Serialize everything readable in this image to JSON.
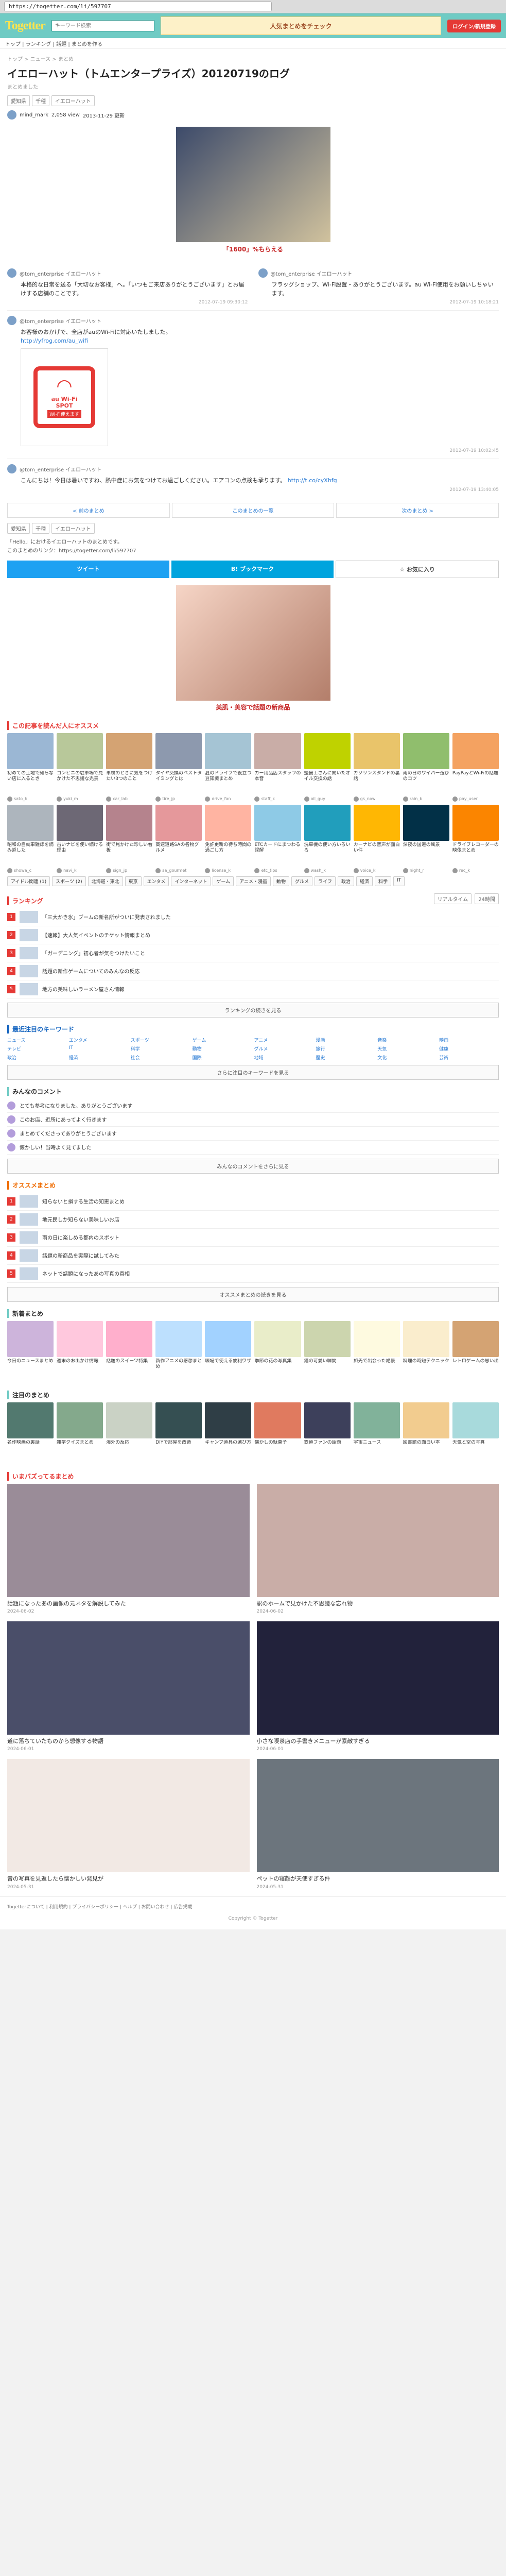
{
  "browser": {
    "url": "https://togetter.com/li/597707"
  },
  "header": {
    "logo": "Togetter",
    "search_placeholder": "キーワード検索",
    "banner_text": "人気まとめをチェック",
    "login": "ログイン/新規登録",
    "submenu": "トップ | ランキング | 話題 | まとめを作る"
  },
  "article": {
    "breadcrumb": "トップ > ニュース > まとめ",
    "title": "イエローハット（トムエンタープライズ）20120719のログ",
    "subtitle": "まとめました",
    "views": "2,058 view",
    "date": "2013-11-29 更新",
    "tags": [
      "愛知県",
      "千種",
      "イエローハット"
    ],
    "author_name": "mind_mark",
    "author_count": "2,058",
    "ad_caption": "「1600」%もらえる",
    "tweets": [
      {
        "user": "@tom_enterprise イエローハット",
        "text": "本格的な日常を送る「大切なお客様」へ。「いつもご来店ありがとうございます」とお届けする店舗のことです。",
        "time": "2012-07-19 09:30:12",
        "has_image": false
      },
      {
        "user": "@tom_enterprise イエローハット",
        "text": "お客様のおかげで、全店がauのWi-Fiに対応いたしました。",
        "link": "http://yfrog.com/au_wifi",
        "time": "2012-07-19 10:02:45",
        "has_image": true
      },
      {
        "user": "@tom_enterprise イエローハット",
        "text": "フラッグショップ、Wi-Fi設置・ありがとうございます。au Wi-Fi使用をお願いしちゃいます。",
        "time": "2012-07-19 10:18:21",
        "has_image": false
      },
      {
        "user": "@tom_enterprise イエローハット",
        "text": "こんにちは！今日は暑いですね、熱中症にお気をつけてお過ごしください。エアコンの点検も承ります。",
        "link": "http://t.co/cyXhfg",
        "time": "2012-07-19 13:40:05",
        "has_image": false
      }
    ],
    "wifi_badge": {
      "brand": "au Wi-Fi",
      "label": "SPOT",
      "sub": "Wi-Fi使えます"
    },
    "pager": [
      "< 前のまとめ",
      "このまとめの一覧",
      "次のまとめ >"
    ],
    "share": {
      "twitter": "ツイート",
      "hatebu": "B! ブックマーク",
      "fav": "☆ お気に入り"
    },
    "info": [
      "「Hello」におけるイエローハットのまとめです。",
      "このまとめのリンク：https://togetter.com/li/597707"
    ]
  },
  "ad2": {
    "caption": "美肌・美容で話題の新商品"
  },
  "sections": {
    "similar": "この記事を読んだ人にオススメ",
    "ranking": "ランキング",
    "ranking_tabs": [
      "リアルタイム",
      "24時間"
    ],
    "keywords": "最近注目のキーワード",
    "comments": "みんなのコメント",
    "recommend": "オススメまとめ",
    "new": "新着まとめ",
    "pickup": "注目のまとめ",
    "hot": "いまバズってるまとめ"
  },
  "similar_cards": [
    {
      "title": "初めての土地で知らない店に入るとき",
      "user": "sato_k",
      "color": "#9bb7d4"
    },
    {
      "title": "コンビニの駐車場で見かけた不思議な光景",
      "user": "yuki_m",
      "color": "#b8c89a"
    },
    {
      "title": "車検のときに気をつけたい3つのこと",
      "user": "car_lab",
      "color": "#d4a373"
    },
    {
      "title": "タイヤ交換のベストタイミングとは",
      "user": "tire_jp",
      "color": "#8d99ae"
    },
    {
      "title": "夏のドライブで役立つ豆知識まとめ",
      "user": "drive_fan",
      "color": "#a5c4d4"
    },
    {
      "title": "カー用品店スタッフの本音",
      "user": "staff_k",
      "color": "#c9ada7"
    },
    {
      "title": "整備士さんに聞いたオイル交換の話",
      "user": "oil_guy",
      "color": "#bfd200"
    },
    {
      "title": "ガソリンスタンドの裏話",
      "user": "gs_now",
      "color": "#e9c46a"
    },
    {
      "title": "雨の日のワイパー選びのコツ",
      "user": "rain_k",
      "color": "#90be6d"
    },
    {
      "title": "PayPayとWi-Fiの話題",
      "user": "pay_user",
      "color": "#f4a261"
    },
    {
      "title": "昭和の自動車雑誌を読み返した",
      "user": "showa_c",
      "color": "#adb5bd"
    },
    {
      "title": "古いナビを使い続ける理由",
      "user": "navi_k",
      "color": "#6d6875"
    },
    {
      "title": "街で見かけた珍しい看板",
      "user": "sign_jp",
      "color": "#b5838d"
    },
    {
      "title": "高速道路SAの名物グルメ",
      "user": "sa_gourmet",
      "color": "#e5989b"
    },
    {
      "title": "免許更新の待ち時間の過ごし方",
      "user": "license_k",
      "color": "#ffb4a2"
    },
    {
      "title": "ETCカードにまつわる誤解",
      "user": "etc_tips",
      "color": "#8ecae6"
    },
    {
      "title": "洗車機の使い方いろいろ",
      "user": "wash_k",
      "color": "#219ebc"
    },
    {
      "title": "カーナビの音声が面白い件",
      "user": "voice_k",
      "color": "#ffb703"
    },
    {
      "title": "深夜の国道の風景",
      "user": "night_r",
      "color": "#023047"
    },
    {
      "title": "ドライブレコーダーの映像まとめ",
      "user": "rec_k",
      "color": "#fb8500"
    }
  ],
  "chips": [
    "アイドル関連 (1)",
    "スポーツ (2)",
    "北海道・東北",
    "東京",
    "エンタメ",
    "インターネット",
    "ゲーム",
    "アニメ・漫画",
    "動物",
    "グルメ",
    "ライフ",
    "政治",
    "経済",
    "科学",
    "IT"
  ],
  "ranking_rows": [
    "「三大かき氷」ブームの新名所がついに発表されました",
    "【速報】大人気イベントのチケット情報まとめ",
    "「ガーデニング」初心者が気をつけたいこと",
    "話題の新作ゲームについてのみんなの反応",
    "地方の美味しいラーメン屋さん情報"
  ],
  "ranking_more": "ランキングの続きを見る",
  "keywords": [
    "ニュース",
    "エンタメ",
    "スポーツ",
    "ゲーム",
    "アニメ",
    "漫画",
    "音楽",
    "映画",
    "テレビ",
    "IT",
    "科学",
    "動物",
    "グルメ",
    "旅行",
    "天気",
    "健康",
    "政治",
    "経済",
    "社会",
    "国際",
    "地域",
    "歴史",
    "文化",
    "芸術"
  ],
  "keywords_more": "さらに注目のキーワードを見る",
  "comments": [
    "とても参考になりました、ありがとうございます",
    "このお店、近所にあってよく行きます",
    "まとめてくださってありがとうございます",
    "懐かしい！当時よく見てました"
  ],
  "comments_more": "みんなのコメントをさらに見る",
  "recommend_rows": [
    "知らないと損する生活の知恵まとめ",
    "地元民しか知らない美味しいお店",
    "雨の日に楽しめる都内のスポット",
    "話題の新商品を実際に試してみた",
    "ネットで話題になったあの写真の真相"
  ],
  "recommend_more": "オススメまとめの続きを見る",
  "new_cards": [
    {
      "title": "今日のニュースまとめ",
      "color": "#cdb4db"
    },
    {
      "title": "週末のお出かけ情報",
      "color": "#ffc8dd"
    },
    {
      "title": "話題のスイーツ特集",
      "color": "#ffafcc"
    },
    {
      "title": "新作アニメの感想まとめ",
      "color": "#bde0fe"
    },
    {
      "title": "職場で使える便利ワザ",
      "color": "#a2d2ff"
    },
    {
      "title": "季節の花の写真集",
      "color": "#e9edc9"
    },
    {
      "title": "猫の可愛い瞬間",
      "color": "#ccd5ae"
    },
    {
      "title": "旅先で出会った絶景",
      "color": "#fefae0"
    },
    {
      "title": "料理の時短テクニック",
      "color": "#faedcd"
    },
    {
      "title": "レトロゲームの思い出",
      "color": "#d4a373"
    }
  ],
  "pickup_cards": [
    {
      "title": "名作映画の裏話",
      "color": "#52796f"
    },
    {
      "title": "雑学クイズまとめ",
      "color": "#84a98c"
    },
    {
      "title": "海外の反応",
      "color": "#cad2c5"
    },
    {
      "title": "DIYで部屋を改造",
      "color": "#354f52"
    },
    {
      "title": "キャンプ道具の選び方",
      "color": "#2f3e46"
    },
    {
      "title": "懐かしの駄菓子",
      "color": "#e07a5f"
    },
    {
      "title": "鉄道ファンの話題",
      "color": "#3d405b"
    },
    {
      "title": "宇宙ニュース",
      "color": "#81b29a"
    },
    {
      "title": "図書館の面白い本",
      "color": "#f2cc8f"
    },
    {
      "title": "天気と空の写真",
      "color": "#a8dadc"
    }
  ],
  "hot_cards": [
    {
      "title": "話題になったあの画像の元ネタを解説してみた",
      "date": "2024-06-02",
      "color": "#9a8c98"
    },
    {
      "title": "駅のホームで見かけた不思議な忘れ物",
      "date": "2024-06-02",
      "color": "#c9ada7"
    },
    {
      "title": "道に落ちていたものから想像する物語",
      "date": "2024-06-01",
      "color": "#4a4e69"
    },
    {
      "title": "小さな喫茶店の手書きメニューが素敵すぎる",
      "date": "2024-06-01",
      "color": "#22223b"
    },
    {
      "title": "昔の写真を見返したら懐かしい発見が",
      "date": "2024-05-31",
      "color": "#f2e9e4"
    },
    {
      "title": "ペットの寝顔が天使すぎる件",
      "date": "2024-05-31",
      "color": "#6c757d"
    }
  ],
  "footer": {
    "links": "Togetterについて | 利用規約 | プライバシーポリシー | ヘルプ | お問い合わせ | 広告掲載",
    "copy": "Copyright © Togetter"
  }
}
